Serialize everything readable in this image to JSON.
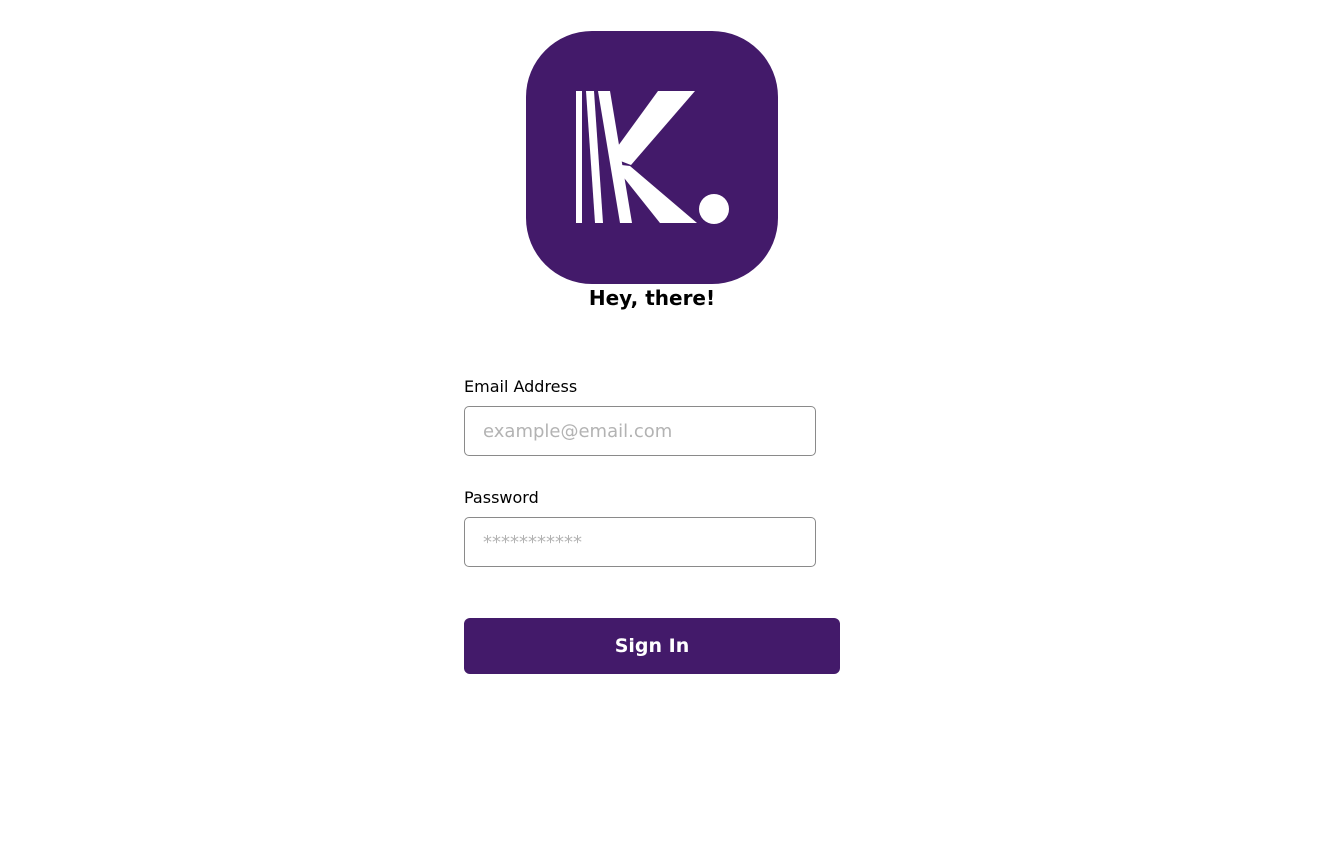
{
  "brand": {
    "logo_icon": "k-dot-logo-icon",
    "color": "#431a6a"
  },
  "greeting": "Hey, there!",
  "form": {
    "email_label": "Email Address",
    "email_placeholder": "example@email.com",
    "password_label": "Password",
    "password_placeholder": "***********",
    "submit_label": "Sign In"
  }
}
